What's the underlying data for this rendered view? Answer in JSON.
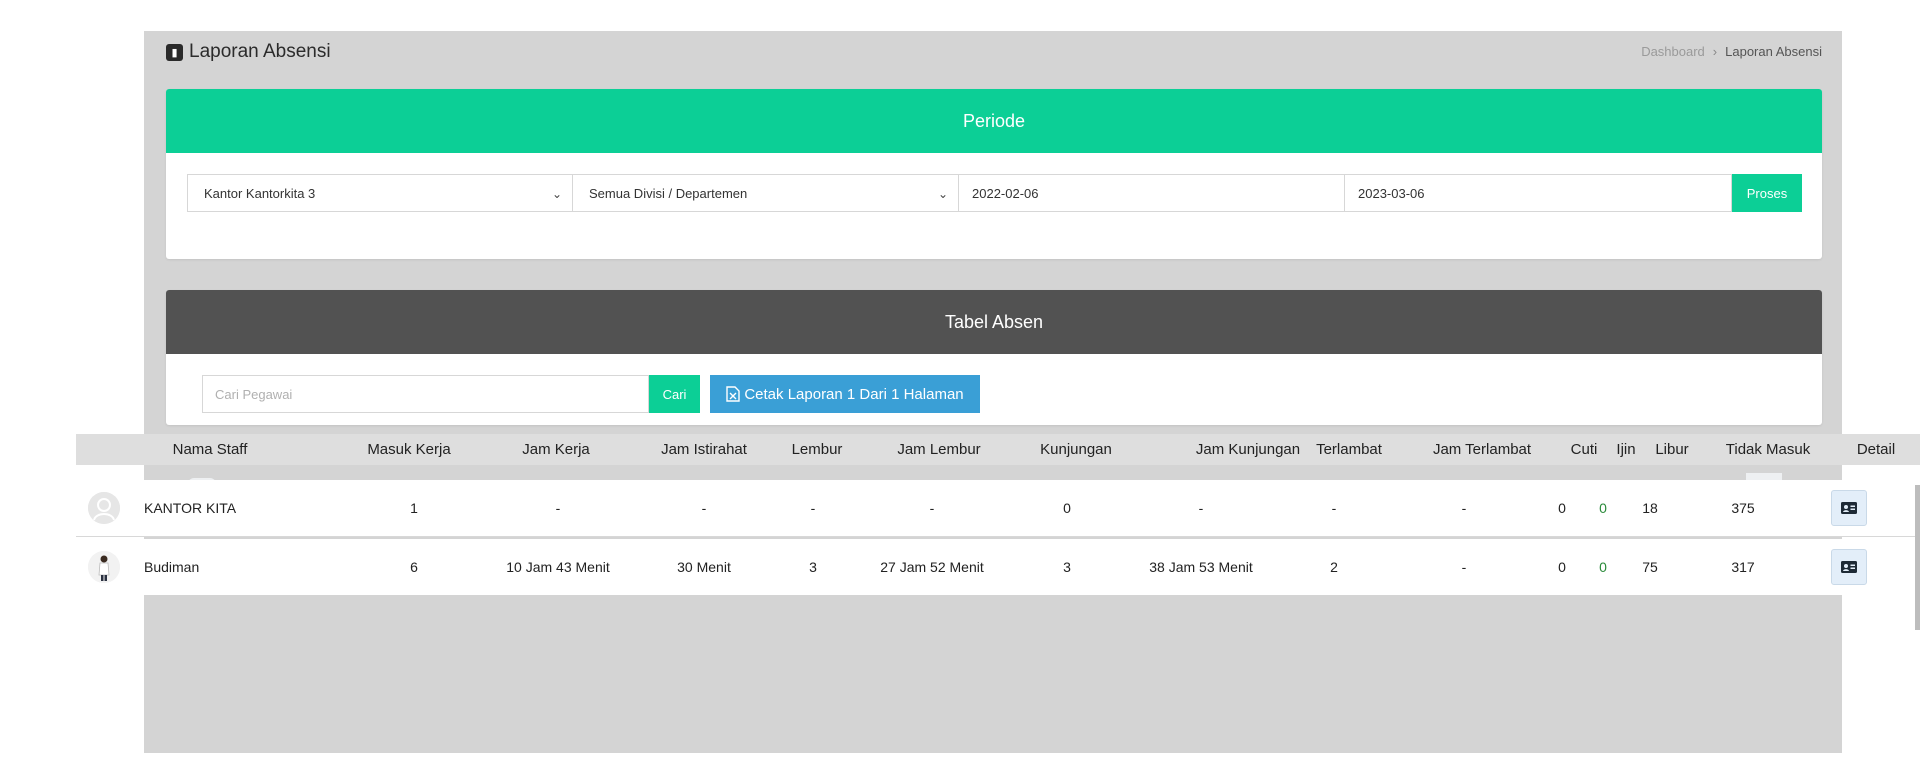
{
  "page": {
    "title": "Laporan Absensi"
  },
  "breadcrumb": {
    "home": "Dashboard",
    "current": "Laporan Absensi"
  },
  "periode": {
    "title": "Periode",
    "kantor": "Kantor Kantorkita 3",
    "divisi": "Semua Divisi / Departemen",
    "date_from": "2022-02-06",
    "date_to": "2023-03-06",
    "proses_label": "Proses"
  },
  "tabel": {
    "title": "Tabel Absen",
    "search_placeholder": "Cari Pegawai",
    "cari_label": "Cari",
    "cetak_label": "Cetak Laporan 1 Dari 1 Halaman"
  },
  "columns": [
    "Nama Staff",
    "Masuk Kerja",
    "Jam Kerja",
    "Jam Istirahat",
    "Lembur",
    "Jam Lembur",
    "Kunjungan",
    "Jam Kunjungan",
    "Terlambat",
    "Jam Terlambat",
    "Cuti",
    "Ijin",
    "Libur",
    "Tidak Masuk",
    "Detail"
  ],
  "rows": [
    {
      "name": "KANTOR KITA",
      "masuk_kerja": "1",
      "jam_kerja": "-",
      "jam_istirahat": "-",
      "lembur": "-",
      "jam_lembur": "-",
      "kunjungan": "0",
      "jam_kunjungan": "-",
      "terlambat": "-",
      "jam_terlambat": "-",
      "cuti": "0",
      "ijin": "0",
      "libur": "18",
      "tidak_masuk": "375"
    },
    {
      "name": "Budiman",
      "masuk_kerja": "6",
      "jam_kerja": "10 Jam 43 Menit",
      "jam_istirahat": "30 Menit",
      "lembur": "3",
      "jam_lembur": "27 Jam 52 Menit",
      "kunjungan": "3",
      "jam_kunjungan": "38 Jam 53 Menit",
      "terlambat": "2",
      "jam_terlambat": "-",
      "cuti": "0",
      "ijin": "0",
      "libur": "75",
      "tidak_masuk": "317"
    }
  ],
  "colors": {
    "primary_green": "#0ccf96",
    "dark_header": "#525252",
    "blue_button": "#3a9fd6",
    "ijin_green": "#2a8a3a"
  },
  "icons": {
    "page": "contact-book-icon",
    "print": "file-excel-icon",
    "detail": "id-card-icon",
    "avatar_default": "user-silhouette-icon"
  }
}
